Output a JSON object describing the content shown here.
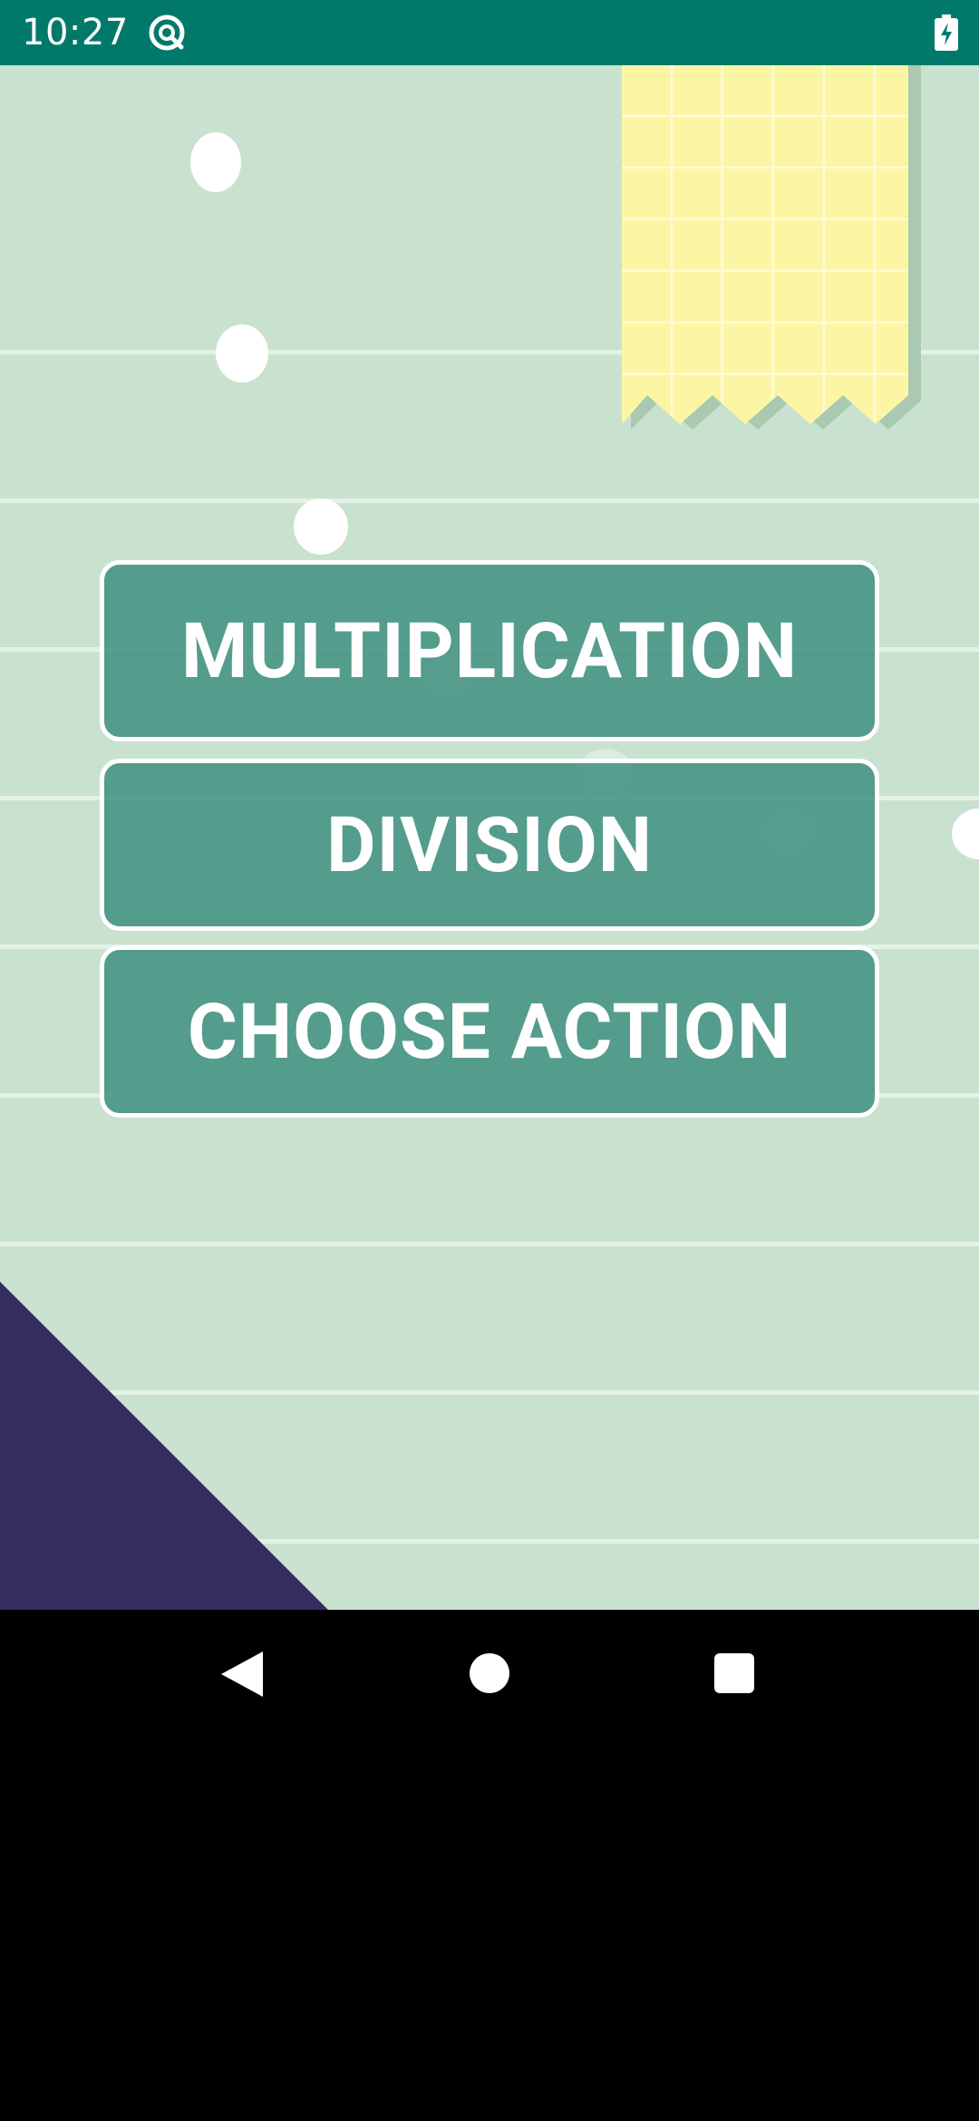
{
  "status_bar": {
    "time": "10:27",
    "app_icon": "at-sign-icon",
    "battery_icon": "battery-charging-icon",
    "background_color": "#00796b"
  },
  "app": {
    "background_color": "#c8e2cf",
    "buttons": {
      "multiplication_label": "MULTIPLICATION",
      "division_label": "DIVISION",
      "choose_action_label": "CHOOSE ACTION",
      "fill_color": "#408f7f"
    },
    "decorations": {
      "notepad_color": "#fcf5a4",
      "triangle_color": "#372d5f"
    }
  },
  "nav_bar": {
    "back_icon": "back-triangle-icon",
    "home_icon": "home-circle-icon",
    "recents_icon": "recents-square-icon"
  }
}
